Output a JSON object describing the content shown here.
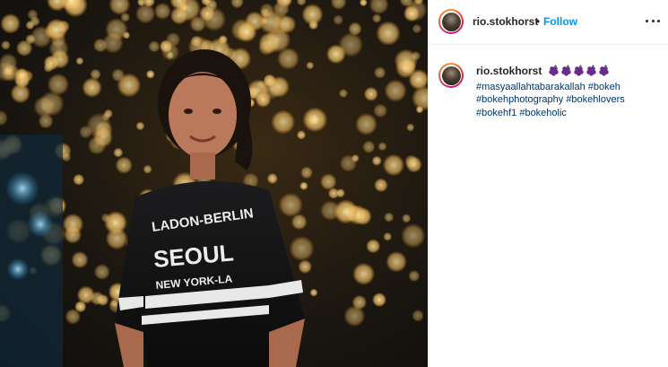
{
  "post": {
    "image_alt": "",
    "author": "rio.stokhorst",
    "separator": "•",
    "follow_label": "Follow",
    "more_icon": "more-options-icon"
  },
  "caption": {
    "author": "rio.stokhorst",
    "emoji_icon": "grapes-emoji-icon",
    "emoji_count": 5,
    "hashtags": [
      "#masyaallahtabarakallah",
      "#bokeh",
      "#bokehphotography",
      "#bokehlovers",
      "#bokehf1",
      "#bokeholic"
    ]
  },
  "colors": {
    "follow": "#0095f6",
    "hashtag": "#00376b",
    "text": "#262626",
    "divider": "#efefef",
    "emoji": "#6b2a8f"
  }
}
